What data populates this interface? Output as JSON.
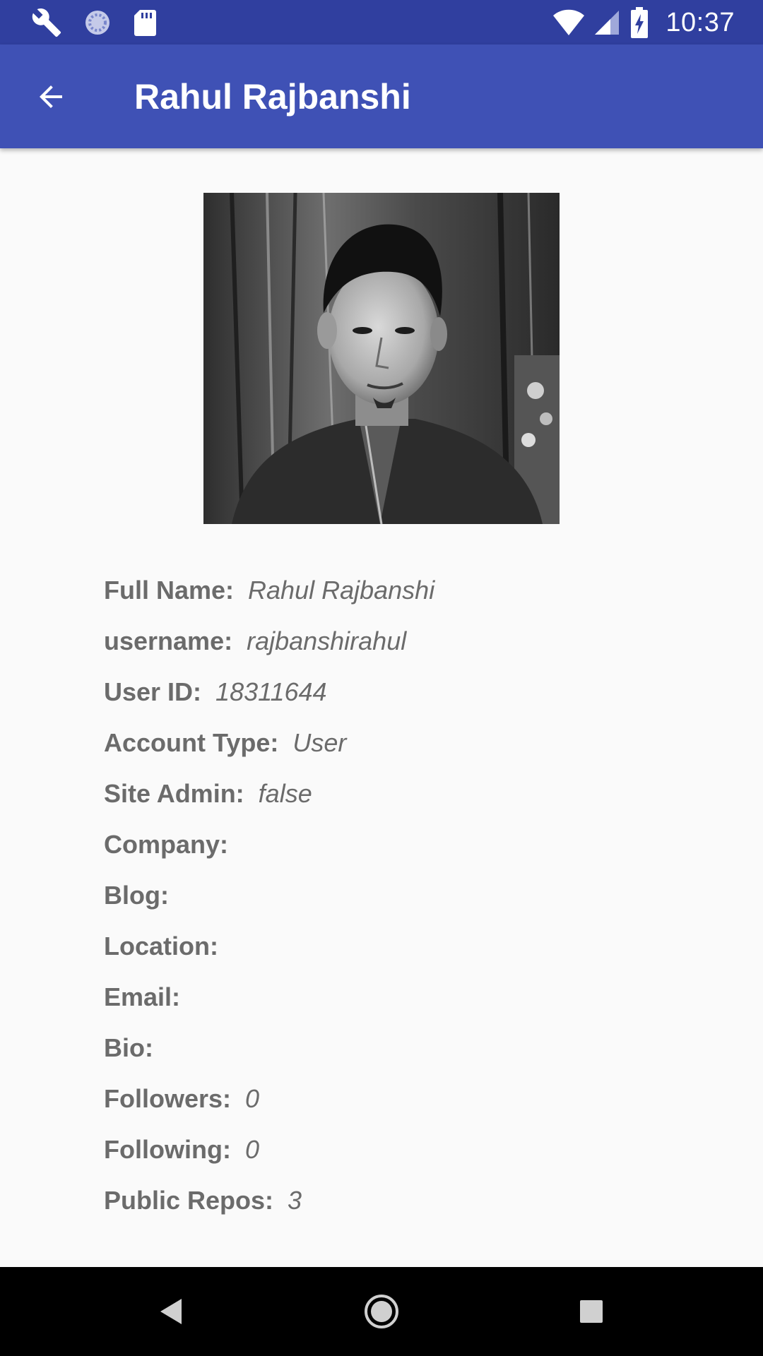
{
  "status_bar": {
    "time": "10:37",
    "left_icons": [
      "wrench-icon",
      "sync-circle-icon",
      "sd-card-icon"
    ],
    "right_icons": [
      "wifi-icon",
      "cell-signal-icon",
      "battery-charging-icon"
    ],
    "background_color": "#303f9f"
  },
  "app_bar": {
    "title": "Rahul Rajbanshi",
    "back_icon": "arrow-back-icon",
    "background_color": "#3f51b5"
  },
  "profile": {
    "photo_icon": "profile-photo",
    "fields": [
      {
        "label": "Full Name:",
        "value": "Rahul Rajbanshi"
      },
      {
        "label": "username:",
        "value": "rajbanshirahul"
      },
      {
        "label": "User ID:",
        "value": "18311644"
      },
      {
        "label": "Account Type:",
        "value": "User"
      },
      {
        "label": "Site Admin:",
        "value": "false"
      },
      {
        "label": "Company:",
        "value": ""
      },
      {
        "label": "Blog:",
        "value": ""
      },
      {
        "label": "Location:",
        "value": ""
      },
      {
        "label": "Email:",
        "value": ""
      },
      {
        "label": "Bio:",
        "value": ""
      },
      {
        "label": "Followers:",
        "value": "0"
      },
      {
        "label": "Following:",
        "value": "0"
      },
      {
        "label": "Public Repos:",
        "value": "3"
      }
    ]
  },
  "nav_bar": {
    "buttons": [
      "nav-back-icon",
      "nav-home-icon",
      "nav-recents-icon"
    ]
  }
}
